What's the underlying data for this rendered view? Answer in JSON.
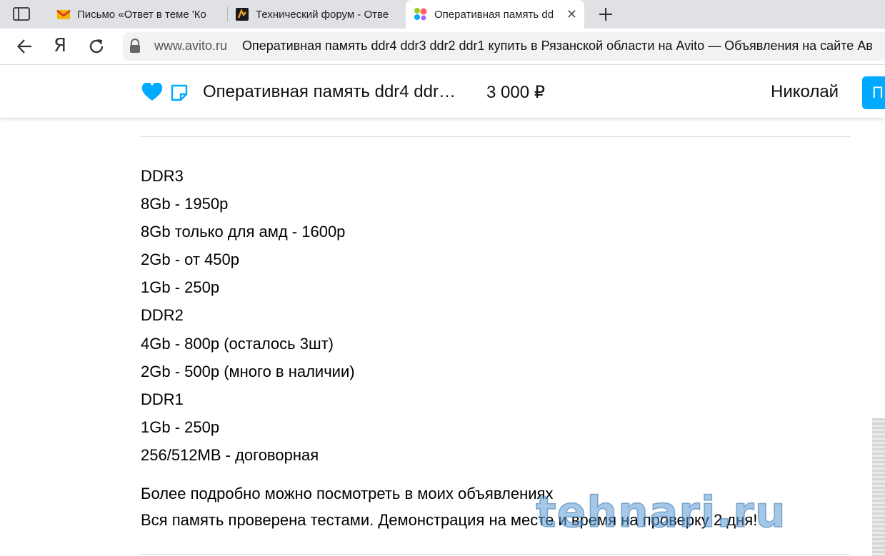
{
  "browser": {
    "tabs": [
      {
        "title": "Письмо «Ответ в теме 'Ко",
        "icon": "gmail-icon"
      },
      {
        "title": "Технический форум - Отве",
        "icon": "forum-icon"
      },
      {
        "title": "Оперативная память dd",
        "icon": "avito-icon",
        "active": true
      }
    ],
    "new_tab_icon": "plus-icon",
    "address": {
      "domain": "www.avito.ru",
      "page_title": "Оперативная память ddr4 ddr3 ddr2 ddr1 купить в Рязанской области на Avito — Объявления на сайте Ав"
    },
    "yandex_button": "Я"
  },
  "header": {
    "title": "Оперативная память ddr4 ddr…",
    "price": "3 000  ₽",
    "seller": "Николай",
    "contact_button": "П",
    "accent_color": "#00aaff"
  },
  "description": {
    "lines": [
      "DDR3",
      "8Gb - 1950р",
      "8Gb только для амд - 1600р",
      "2Gb - от 450р",
      "1Gb - 250р",
      "DDR2",
      "4Gb - 800р (осталось 3шт)",
      "2Gb - 500р (много в наличии)",
      "DDR1",
      "1Gb - 250р",
      "256/512MB - договорная"
    ],
    "footer_lines": [
      "Более подробно можно посмотреть в моих объявлениях",
      "Вся память проверена тестами. Демонстрация на месте и время на проверку 2 дня!"
    ]
  },
  "watermark": {
    "text": "tehnari.ru"
  }
}
